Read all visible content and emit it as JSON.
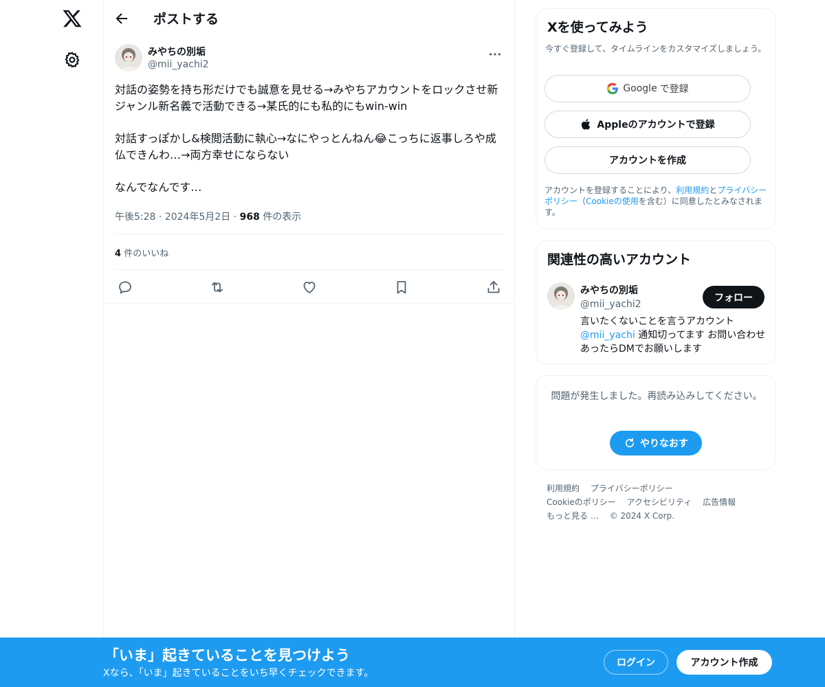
{
  "nav": {
    "logo_icon": "x-logo-icon",
    "settings_icon": "gear-icon"
  },
  "header": {
    "title": "ポストする",
    "back_icon": "arrow-left-icon"
  },
  "post": {
    "author_name": "みやちの別垢",
    "author_handle": "@mii_yachi2",
    "paragraphs": [
      "対話の姿勢を持ち形だけでも誠意を見せる→みやちアカウントをロックさせ新ジャンル新名義で活動できる→某氏的にも私的にもwin-win",
      "対話すっぽかし&検閲活動に執心→なにやっとんねん😂こっちに返事しろや成仏できんわ…→両方幸せにならない",
      "なんでなんです…"
    ],
    "time": "午後5:28",
    "date": "2024年5月2日",
    "view_count": "968",
    "view_label": "件の表示",
    "like_count": "4",
    "like_label": "件のいいね"
  },
  "signup": {
    "title": "Xを使ってみよう",
    "subtitle": "今すぐ登録して、タイムラインをカスタマイズしましょう。",
    "google_word": "Google",
    "google_suffix": "で登録",
    "apple_button": "Appleのアカウントで登録",
    "create_button": "アカウントを作成",
    "legal_pre": "アカウントを登録することにより、",
    "legal_terms": "利用規約",
    "legal_and": "と",
    "legal_privacy": "プライバシーポリシー",
    "legal_mid": "（",
    "legal_cookie": "Cookieの使用",
    "legal_post": "を含む）に同意したとみなされます。"
  },
  "related": {
    "title": "関連性の高いアカウント",
    "name": "みやちの別垢",
    "handle": "@mii_yachi2",
    "follow_button": "フォロー",
    "bio_pre": "言いたくないことを言うアカウント",
    "bio_link": "@mii_yachi",
    "bio_post": "通知切ってます お問い合わせあったらDMでお願いします"
  },
  "error": {
    "message": "問題が発生しました。再読み込みしてください。",
    "retry_button": "やりなおす"
  },
  "footer": {
    "links": [
      "利用規約",
      "プライバシーポリシー",
      "Cookieのポリシー",
      "アクセシビリティ",
      "広告情報",
      "もっと見る …",
      "© 2024 X Corp."
    ]
  },
  "banner": {
    "title": "「いま」起きていることを見つけよう",
    "subtitle": "Xなら、「いま」起きていることをいち早くチェックできます。",
    "login_button": "ログイン",
    "create_button": "アカウント作成"
  },
  "colors": {
    "accent": "#1d9bf0",
    "text": "#0f1419",
    "muted": "#536471"
  }
}
